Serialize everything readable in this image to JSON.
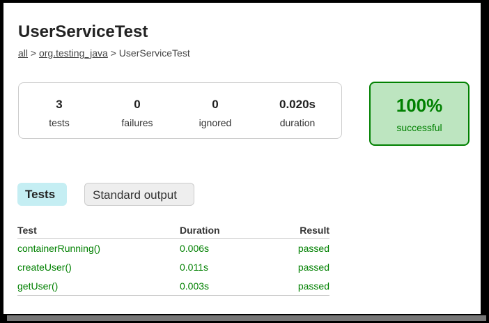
{
  "title": "UserServiceTest",
  "breadcrumb": {
    "items": [
      "all",
      "org.testing_java"
    ],
    "separator": ">",
    "current": "UserServiceTest"
  },
  "summary": {
    "tests": {
      "value": "3",
      "label": "tests"
    },
    "failures": {
      "value": "0",
      "label": "failures"
    },
    "ignored": {
      "value": "0",
      "label": "ignored"
    },
    "duration": {
      "value": "0.020s",
      "label": "duration"
    }
  },
  "success": {
    "percent": "100%",
    "label": "successful"
  },
  "tabs": [
    {
      "label": "Tests",
      "active": true
    },
    {
      "label": "Standard output",
      "active": false
    }
  ],
  "table": {
    "headers": [
      "Test",
      "Duration",
      "Result"
    ],
    "rows": [
      {
        "test": "containerRunning()",
        "duration": "0.006s",
        "result": "passed"
      },
      {
        "test": "createUser()",
        "duration": "0.011s",
        "result": "passed"
      },
      {
        "test": "getUser()",
        "duration": "0.003s",
        "result": "passed"
      }
    ]
  },
  "colors": {
    "success": "#008000",
    "success_bg": "#bde5c0",
    "active_tab": "#c5eef3"
  }
}
